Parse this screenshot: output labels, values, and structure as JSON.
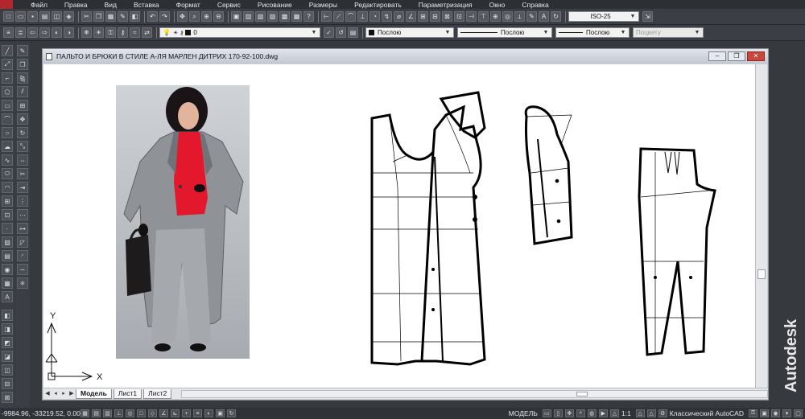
{
  "menu": [
    "Файл",
    "Правка",
    "Вид",
    "Вставка",
    "Формат",
    "Сервис",
    "Рисование",
    "Размеры",
    "Редактировать",
    "Параметризация",
    "Окно",
    "Справка"
  ],
  "toolbar1": {
    "dimstyle": "ISO-25"
  },
  "toolbar2": {
    "layer": "0",
    "color": "Послою",
    "linetype": "Послою",
    "lineweight": "Послою",
    "plotstyle": "Поцвету"
  },
  "drawing": {
    "title": "ПАЛЬТО И БРЮКИ В СТИЛЕ А-ЛЯ МАРЛЕН ДИТРИХ 170-92-100.dwg",
    "ucs_x": "X",
    "ucs_y": "Y"
  },
  "layout_tabs": [
    "Модель",
    "Лист1",
    "Лист2"
  ],
  "brand": "Autodesk",
  "status": {
    "coords": "-9984.96, -33219.52, 0.00",
    "space": "МОДЕЛЬ",
    "scale": "1:1",
    "workspace": "Классический AutoCAD"
  },
  "colors": {
    "accent": "#b3262b",
    "sweater": "#e3182c",
    "coat": "#8f9296"
  }
}
